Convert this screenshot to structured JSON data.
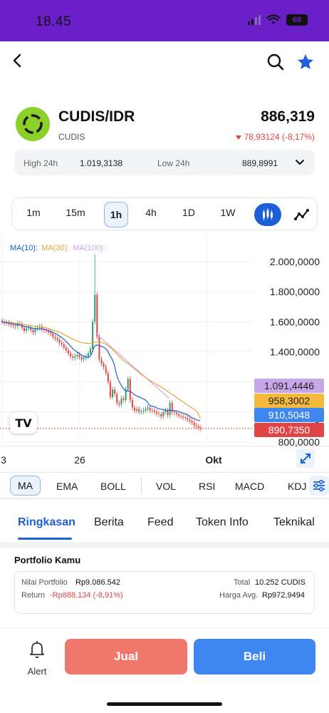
{
  "status": {
    "time": "18.45",
    "battery": "68"
  },
  "nav": {
    "back_icon": "chevron-left-icon",
    "search_icon": "search-icon",
    "favorite_icon": "star-icon"
  },
  "colors": {
    "accent": "#1d5fd8",
    "down": "#e04444",
    "up": "#2e9a6c",
    "status_bar": "#6a1fc9",
    "sell": "#f1776c",
    "buy": "#3e86f0",
    "ma10": "#1d5fd8",
    "ma30": "#e9a43c",
    "ma100": "#c9a6e8"
  },
  "header": {
    "pair": "CUDIS/IDR",
    "coin_name": "CUDIS",
    "price": "886,319",
    "change": "78,93124 (-8,17%)"
  },
  "stats": {
    "high_label": "High 24h",
    "high_value": "1.019,3138",
    "low_label": "Low 24h",
    "low_value": "889,8991"
  },
  "timeframes": {
    "items": [
      "1m",
      "15m",
      "1h",
      "4h",
      "1D",
      "1W"
    ],
    "selected": "1h"
  },
  "legend": {
    "ma10": "MA(10):",
    "ma30": "MA(30):",
    "ma100": "MA(100):"
  },
  "chart_data": {
    "type": "candlestick",
    "y_ticks": [
      "2.000,0000",
      "1.800,0000",
      "1.600,0000",
      "1.400,0000",
      "800,0000"
    ],
    "y_range": [
      800,
      2000
    ],
    "x_ticks": [
      "3",
      "26",
      "Okt"
    ],
    "price_tags": [
      {
        "label": "1.091,4446",
        "value": 1091.4446,
        "color": "#c9a6e8",
        "series": "MA(100)"
      },
      {
        "label": "958,3002",
        "value": 958.3002,
        "color": "#f4b93a",
        "series": "MA(30)"
      },
      {
        "label": "910,5048",
        "value": 910.5048,
        "color": "#3e86f0",
        "series": "MA(10)"
      },
      {
        "label": "890,7350",
        "value": 890.735,
        "color": "#e04444",
        "series": "Last price"
      }
    ],
    "partial_label": "0",
    "close": [
      1600,
      1590,
      1595,
      1585,
      1580,
      1575,
      1570,
      1590,
      1585,
      1560,
      1540,
      1555,
      1560,
      1545,
      1530,
      1555,
      1560,
      1570,
      1550,
      1545,
      1540,
      1530,
      1520,
      1500,
      1490,
      1480,
      1460,
      1450,
      1430,
      1410,
      1390,
      1370,
      1360,
      1370,
      1380,
      1365,
      1350,
      1360,
      1370,
      1390,
      1420,
      1600,
      1780,
      1500,
      1350,
      1320,
      1300,
      1260,
      1200,
      1100,
      1150,
      1120,
      1060,
      1050,
      1090,
      1080,
      1150,
      1220,
      1080,
      1030,
      1010,
      1020,
      1000,
      1005,
      1010,
      1020,
      1030,
      1010,
      1010,
      1000,
      990,
      985,
      970,
      1000,
      1010,
      980,
      1060,
      1000,
      995,
      985,
      975,
      970,
      965,
      960,
      950,
      940,
      930,
      910,
      905,
      895,
      890
    ],
    "ma10": [
      1600,
      1598,
      1596,
      1593,
      1590,
      1587,
      1584,
      1582,
      1581,
      1577,
      1571,
      1568,
      1566,
      1562,
      1557,
      1555,
      1554,
      1553,
      1552,
      1551,
      1548,
      1543,
      1538,
      1531,
      1525,
      1518,
      1508,
      1499,
      1487,
      1474,
      1459,
      1443,
      1427,
      1413,
      1403,
      1392,
      1382,
      1373,
      1367,
      1364,
      1367,
      1392,
      1434,
      1446,
      1443,
      1438,
      1433,
      1424,
      1409,
      1380,
      1356,
      1322,
      1256,
      1211,
      1185,
      1161,
      1145,
      1141,
      1139,
      1132,
      1118,
      1108,
      1102,
      1097,
      1089,
      1082,
      1070,
      1047,
      1039,
      1036,
      1031,
      1022,
      1019,
      1017,
      1015,
      1009,
      1012,
      1010,
      1009,
      1006,
      1003,
      999,
      994,
      990,
      984,
      976,
      963,
      958,
      951,
      945,
      941
    ],
    "ma30": [
      1600,
      1599,
      1598,
      1597,
      1595,
      1593,
      1591,
      1590,
      1588,
      1586,
      1583,
      1581,
      1579,
      1576,
      1573,
      1571,
      1569,
      1567,
      1565,
      1563,
      1560,
      1556,
      1552,
      1547,
      1542,
      1537,
      1531,
      1525,
      1518,
      1511,
      1503,
      1495,
      1487,
      1480,
      1474,
      1468,
      1463,
      1460,
      1458,
      1457,
      1457,
      1460,
      1464,
      1466,
      1466,
      1464,
      1460,
      1453,
      1444,
      1433,
      1420,
      1406,
      1391,
      1376,
      1361,
      1347,
      1335,
      1325,
      1314,
      1302,
      1290,
      1278,
      1266,
      1254,
      1243,
      1232,
      1222,
      1212,
      1203,
      1194,
      1186,
      1178,
      1170,
      1160,
      1150,
      1140,
      1130,
      1120,
      1110,
      1100,
      1090,
      1080,
      1070,
      1060,
      1050,
      1040,
      1030,
      1020,
      1010,
      995,
      958
    ],
    "ma100_start_index": 43,
    "ma100": [
      1520,
      1507,
      1494,
      1481,
      1468,
      1455,
      1442,
      1429,
      1416,
      1403,
      1390,
      1377,
      1364,
      1351,
      1338,
      1325,
      1312,
      1299,
      1286,
      1273,
      1260,
      1247,
      1234,
      1221,
      1208,
      1195,
      1182,
      1169,
      1156,
      1143,
      1130,
      1117,
      1104,
      1091
    ]
  },
  "indicators": {
    "items": [
      "MA",
      "EMA",
      "BOLL",
      "VOL",
      "RSI",
      "MACD",
      "KDJ"
    ],
    "selected": "MA"
  },
  "tabs": {
    "items": [
      "Ringkasan",
      "Berita",
      "Feed",
      "Token Info",
      "Teknikal"
    ],
    "selected": "Ringkasan"
  },
  "portfolio": {
    "title": "Portfolio Kamu",
    "value_label": "Nilai Portfolio",
    "value": "Rp9.086.542",
    "return_label": "Return",
    "return_value": "-Rp888.134 (-8,91%)",
    "total_label": "Total",
    "total_value": "10.252 CUDIS",
    "avg_label": "Harga Avg.",
    "avg_value": "Rp972,9494"
  },
  "actions": {
    "alert_label": "Alert",
    "sell_label": "Jual",
    "buy_label": "Beli"
  }
}
